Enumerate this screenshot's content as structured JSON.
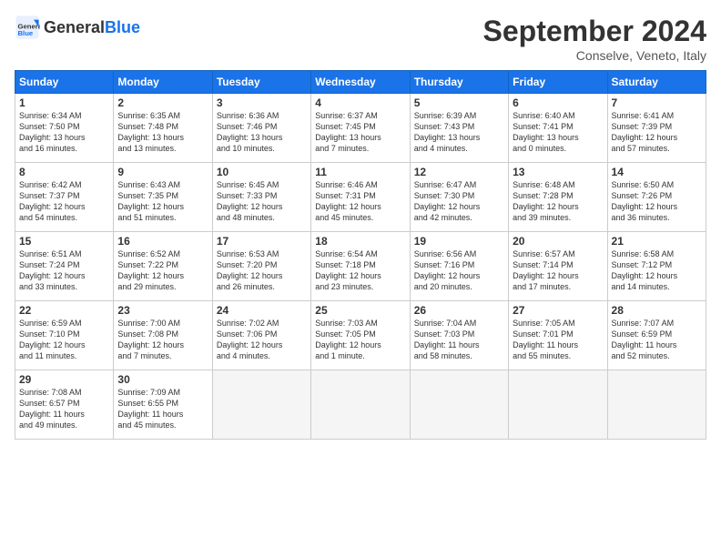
{
  "logo": {
    "text_general": "General",
    "text_blue": "Blue"
  },
  "header": {
    "month_title": "September 2024",
    "subtitle": "Conselve, Veneto, Italy"
  },
  "weekdays": [
    "Sunday",
    "Monday",
    "Tuesday",
    "Wednesday",
    "Thursday",
    "Friday",
    "Saturday"
  ],
  "weeks": [
    [
      {
        "day": "1",
        "info": "Sunrise: 6:34 AM\nSunset: 7:50 PM\nDaylight: 13 hours\nand 16 minutes."
      },
      {
        "day": "2",
        "info": "Sunrise: 6:35 AM\nSunset: 7:48 PM\nDaylight: 13 hours\nand 13 minutes."
      },
      {
        "day": "3",
        "info": "Sunrise: 6:36 AM\nSunset: 7:46 PM\nDaylight: 13 hours\nand 10 minutes."
      },
      {
        "day": "4",
        "info": "Sunrise: 6:37 AM\nSunset: 7:45 PM\nDaylight: 13 hours\nand 7 minutes."
      },
      {
        "day": "5",
        "info": "Sunrise: 6:39 AM\nSunset: 7:43 PM\nDaylight: 13 hours\nand 4 minutes."
      },
      {
        "day": "6",
        "info": "Sunrise: 6:40 AM\nSunset: 7:41 PM\nDaylight: 13 hours\nand 0 minutes."
      },
      {
        "day": "7",
        "info": "Sunrise: 6:41 AM\nSunset: 7:39 PM\nDaylight: 12 hours\nand 57 minutes."
      }
    ],
    [
      {
        "day": "8",
        "info": "Sunrise: 6:42 AM\nSunset: 7:37 PM\nDaylight: 12 hours\nand 54 minutes."
      },
      {
        "day": "9",
        "info": "Sunrise: 6:43 AM\nSunset: 7:35 PM\nDaylight: 12 hours\nand 51 minutes."
      },
      {
        "day": "10",
        "info": "Sunrise: 6:45 AM\nSunset: 7:33 PM\nDaylight: 12 hours\nand 48 minutes."
      },
      {
        "day": "11",
        "info": "Sunrise: 6:46 AM\nSunset: 7:31 PM\nDaylight: 12 hours\nand 45 minutes."
      },
      {
        "day": "12",
        "info": "Sunrise: 6:47 AM\nSunset: 7:30 PM\nDaylight: 12 hours\nand 42 minutes."
      },
      {
        "day": "13",
        "info": "Sunrise: 6:48 AM\nSunset: 7:28 PM\nDaylight: 12 hours\nand 39 minutes."
      },
      {
        "day": "14",
        "info": "Sunrise: 6:50 AM\nSunset: 7:26 PM\nDaylight: 12 hours\nand 36 minutes."
      }
    ],
    [
      {
        "day": "15",
        "info": "Sunrise: 6:51 AM\nSunset: 7:24 PM\nDaylight: 12 hours\nand 33 minutes."
      },
      {
        "day": "16",
        "info": "Sunrise: 6:52 AM\nSunset: 7:22 PM\nDaylight: 12 hours\nand 29 minutes."
      },
      {
        "day": "17",
        "info": "Sunrise: 6:53 AM\nSunset: 7:20 PM\nDaylight: 12 hours\nand 26 minutes."
      },
      {
        "day": "18",
        "info": "Sunrise: 6:54 AM\nSunset: 7:18 PM\nDaylight: 12 hours\nand 23 minutes."
      },
      {
        "day": "19",
        "info": "Sunrise: 6:56 AM\nSunset: 7:16 PM\nDaylight: 12 hours\nand 20 minutes."
      },
      {
        "day": "20",
        "info": "Sunrise: 6:57 AM\nSunset: 7:14 PM\nDaylight: 12 hours\nand 17 minutes."
      },
      {
        "day": "21",
        "info": "Sunrise: 6:58 AM\nSunset: 7:12 PM\nDaylight: 12 hours\nand 14 minutes."
      }
    ],
    [
      {
        "day": "22",
        "info": "Sunrise: 6:59 AM\nSunset: 7:10 PM\nDaylight: 12 hours\nand 11 minutes."
      },
      {
        "day": "23",
        "info": "Sunrise: 7:00 AM\nSunset: 7:08 PM\nDaylight: 12 hours\nand 7 minutes."
      },
      {
        "day": "24",
        "info": "Sunrise: 7:02 AM\nSunset: 7:06 PM\nDaylight: 12 hours\nand 4 minutes."
      },
      {
        "day": "25",
        "info": "Sunrise: 7:03 AM\nSunset: 7:05 PM\nDaylight: 12 hours\nand 1 minute."
      },
      {
        "day": "26",
        "info": "Sunrise: 7:04 AM\nSunset: 7:03 PM\nDaylight: 11 hours\nand 58 minutes."
      },
      {
        "day": "27",
        "info": "Sunrise: 7:05 AM\nSunset: 7:01 PM\nDaylight: 11 hours\nand 55 minutes."
      },
      {
        "day": "28",
        "info": "Sunrise: 7:07 AM\nSunset: 6:59 PM\nDaylight: 11 hours\nand 52 minutes."
      }
    ],
    [
      {
        "day": "29",
        "info": "Sunrise: 7:08 AM\nSunset: 6:57 PM\nDaylight: 11 hours\nand 49 minutes."
      },
      {
        "day": "30",
        "info": "Sunrise: 7:09 AM\nSunset: 6:55 PM\nDaylight: 11 hours\nand 45 minutes."
      },
      {
        "day": "",
        "info": "",
        "empty": true
      },
      {
        "day": "",
        "info": "",
        "empty": true
      },
      {
        "day": "",
        "info": "",
        "empty": true
      },
      {
        "day": "",
        "info": "",
        "empty": true
      },
      {
        "day": "",
        "info": "",
        "empty": true
      }
    ]
  ]
}
